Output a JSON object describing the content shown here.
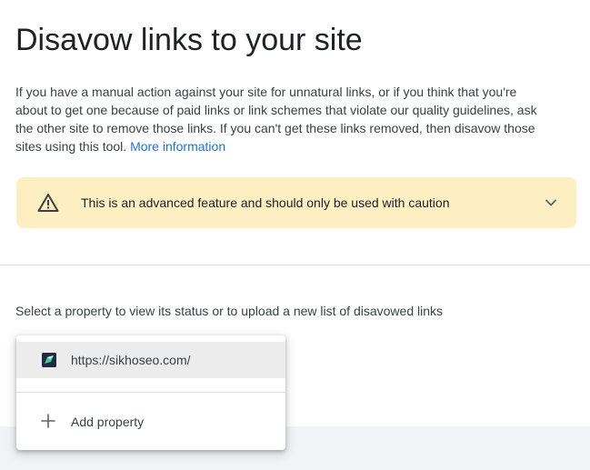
{
  "page": {
    "title": "Disavow links to your site",
    "intro_text": "If you have a manual action against your site for unnatural links, or if you think that you're about to get one because of paid links or link schemes that violate our quality guidelines, ask the other site to remove those links. If you can't get these links removed, then disavow those sites using this tool.",
    "more_info_link": "More information"
  },
  "warning": {
    "icon": "warning-triangle-icon",
    "text": "This is an advanced feature and should only be used with caution",
    "expand_icon": "chevron-down-icon",
    "background_color": "#feefc3"
  },
  "property_selector": {
    "label": "Select a property to view its status or to upload a new list of disavowed links",
    "dropdown": {
      "items": [
        {
          "label": "https://sikhoseo.com/",
          "icon": "site-favicon",
          "selected": true
        }
      ],
      "add_property_label": "Add property",
      "add_icon": "plus-icon"
    }
  },
  "colors": {
    "link": "#1a73e8",
    "text": "#202124",
    "selected_item_bg": "#ececec"
  }
}
